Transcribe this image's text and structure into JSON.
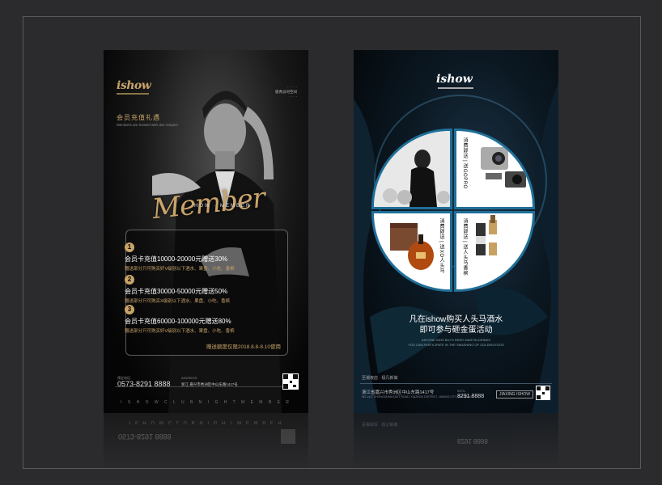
{
  "left_poster": {
    "logo": "ishow",
    "top_right_text": [
      "· · · · ·",
      "极秀派对空间",
      "· · · ·"
    ],
    "title": "会员充值礼遇",
    "subtitle": "Members are treated with due respect",
    "member_script": "Member",
    "member_small": "HOW · MEMBER",
    "tiers": [
      {
        "num": "1",
        "main": "会员卡充值10000-20000元赠送30%",
        "note": "赠送部分只可购买奸V级别以下酒水、果盘、小吃、香槟"
      },
      {
        "num": "2",
        "main": "会员卡充值30000-50000元赠送50%",
        "note": "赠送部分只可购买X级别以下酒水、果盘、小吃、香槟"
      },
      {
        "num": "3",
        "main": "会员卡充值60000-100000元赠送80%",
        "note": "赠送部分只可购买奸V级别以下酒水、果盘、小吃、香槟"
      }
    ],
    "deadline": "赠送额度仅限2018.8.8-8.10使用",
    "phone_label": "预定电话",
    "phone": "0573-8291 8888",
    "address_label": "ADDRESS",
    "address": "浙江 嘉兴市秀洲区中山东路1417号",
    "bottom_text": "I S H O W   C L U B   N I G H T   M E M B E R"
  },
  "right_poster": {
    "logo": "ishow",
    "quadrants": {
      "top_right": "消费即送 | 送GOPRO",
      "bottom_left": "消费即送 | 送XO人头马",
      "bottom_right": "消费即送 | 送人头马香槟"
    },
    "headline_1": "凡在ishow购买人头马酒水",
    "headline_2": "即可参与砸金蛋活动",
    "sub_1": "ANYONE WHO BUYS REMY MARTIN DRINKS",
    "sub_2": "YOU CAN PARTICIPATE IN THE SMASHING OF GOLDEN EGGS",
    "note": "至潮夜店 · 极凡新做",
    "address": "浙江省嘉兴市秀洲区中山东路1417号",
    "address_en": "NO.1417 ZHONGSHAN EAST ROAD, XIUZHOU DISTRICT, JIAXING CITY, ZHEJIANG",
    "phone_label": "0573-",
    "phone": "8291 8888",
    "tag": "JIAXING·ISHOW"
  }
}
